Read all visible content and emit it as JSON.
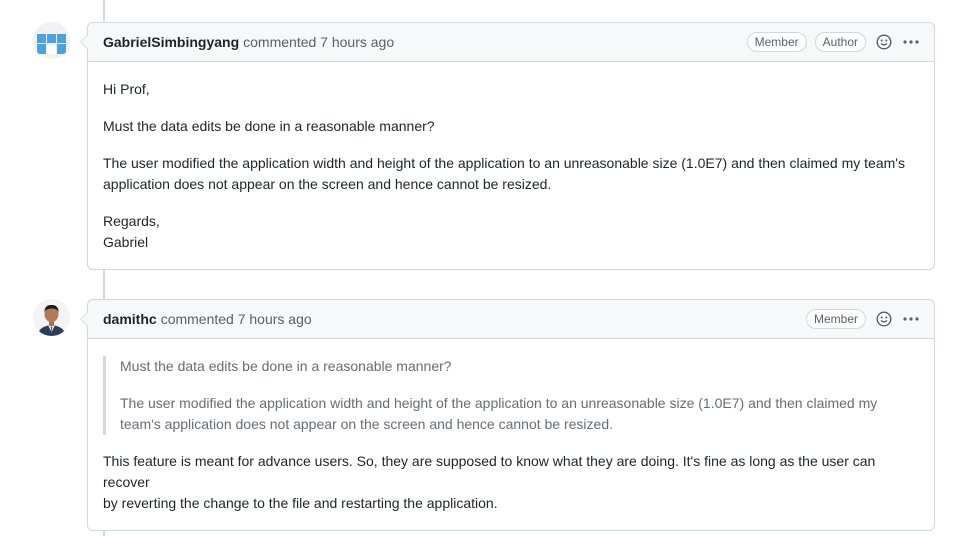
{
  "comments": [
    {
      "author": "GabrielSimbingyang",
      "action": "commented 7 hours ago",
      "badges": [
        "Member",
        "Author"
      ],
      "avatar_icon": "identicon-avatar-icon",
      "body": {
        "p1": "Hi Prof,",
        "p2": "Must the data edits be done in a reasonable manner?",
        "p3_line1": "The user modified the application width and height of the application to an unreasonable size (1.0E7) and then claimed my team's",
        "p3_line2": "application does not appear on the screen and hence cannot be resized.",
        "p4_line1": "Regards,",
        "p4_line2": "Gabriel"
      }
    },
    {
      "author": "damithc",
      "action": "commented 7 hours ago",
      "badges": [
        "Member"
      ],
      "avatar_icon": "user-photo-avatar-icon",
      "quote": {
        "q1": "Must the data edits be done in a reasonable manner?",
        "q2_line1": "The user modified the application width and height of the application to an unreasonable size (1.0E7) and then claimed my",
        "q2_line2": "team's application does not appear on the screen and hence cannot be resized."
      },
      "body": {
        "p1_line1": "This feature is meant for advance users. So, they are supposed to know what they are doing. It's fine as long as the user can recover",
        "p1_line2": "by reverting the change to the file and restarting the application."
      }
    }
  ],
  "icons": {
    "reaction": "smiley-icon",
    "more": "kebab-horizontal-icon"
  },
  "colors": {
    "border": "#d0d7de",
    "header_bg": "#f6f8fa",
    "text": "#1f2328",
    "muted": "#57606a",
    "identicon": "#4aa3df"
  }
}
